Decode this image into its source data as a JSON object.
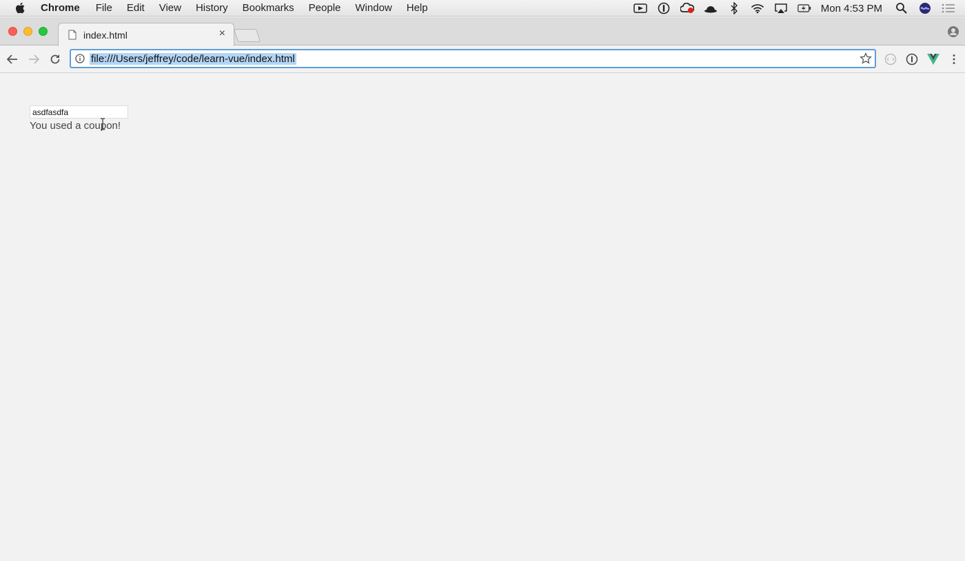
{
  "menubar": {
    "app_name": "Chrome",
    "items": [
      "File",
      "Edit",
      "View",
      "History",
      "Bookmarks",
      "People",
      "Window",
      "Help"
    ],
    "clock": "Mon 4:53 PM"
  },
  "tab": {
    "title": "index.html",
    "close_glyph": "×"
  },
  "omnibox": {
    "url": "file:///Users/jeffrey/code/learn-vue/index.html"
  },
  "page": {
    "coupon_input_value": "asdfasdfa",
    "message": "You used a coupon!"
  },
  "colors": {
    "accent": "#5e9ed6",
    "selection": "#b3d4f4",
    "vue_green": "#41b883"
  }
}
